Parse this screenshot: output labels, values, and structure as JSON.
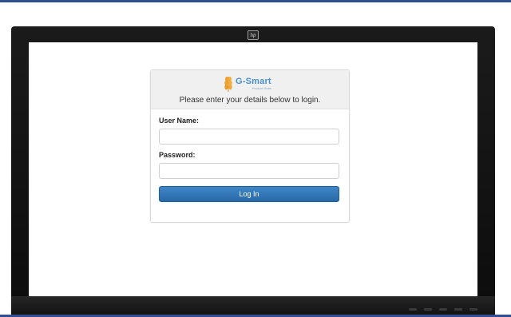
{
  "monitor": {
    "badge_icon": "hp-logo-icon"
  },
  "brand": {
    "name": "G-Smart",
    "subtitle": "Product Suite",
    "logo_icon": "wheat-logo-icon",
    "colors": {
      "name": "#4a90d0",
      "logo": "#f0a030"
    }
  },
  "login": {
    "prompt": "Please enter your details below to login.",
    "username_label": "User Name:",
    "username_value": "",
    "password_label": "Password:",
    "password_value": "",
    "submit_label": "Log In"
  },
  "colors": {
    "accent": "#2f6fae",
    "frame_rule": "#2f4f8f"
  }
}
